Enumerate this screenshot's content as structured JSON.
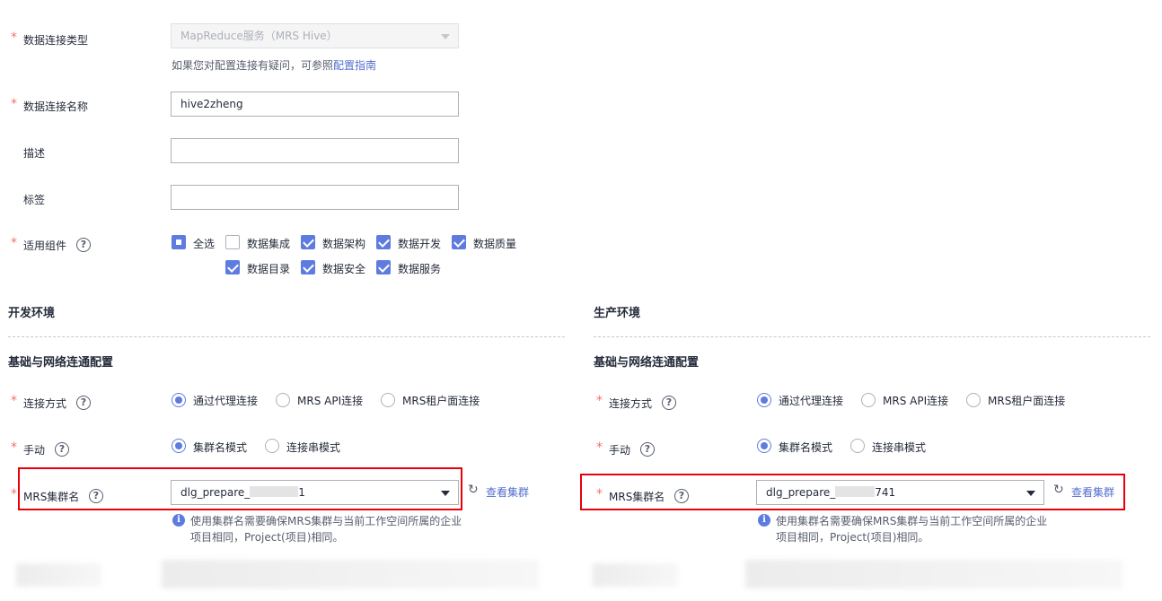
{
  "form": {
    "conn_type": {
      "label": "数据连接类型",
      "value": "MapReduce服务（MRS Hive）",
      "hint_prefix": "如果您对配置连接有疑问，可参照",
      "hint_link": "配置指南"
    },
    "conn_name": {
      "label": "数据连接名称",
      "value": "hive2zheng"
    },
    "desc": {
      "label": "描述",
      "value": ""
    },
    "tags": {
      "label": "标签",
      "value": ""
    },
    "components": {
      "label": "适用组件",
      "items": [
        {
          "label": "全选",
          "state": "partial"
        },
        {
          "label": "数据集成",
          "state": "unchecked"
        },
        {
          "label": "数据架构",
          "state": "checked"
        },
        {
          "label": "数据开发",
          "state": "checked"
        },
        {
          "label": "数据质量",
          "state": "checked"
        },
        {
          "label": "数据目录",
          "state": "checked"
        },
        {
          "label": "数据安全",
          "state": "checked"
        },
        {
          "label": "数据服务",
          "state": "checked"
        }
      ]
    }
  },
  "dev": {
    "title": "开发环境",
    "subtitle": "基础与网络连通配置",
    "conn_method": {
      "label": "连接方式",
      "options": [
        "通过代理连接",
        "MRS API连接",
        "MRS租户面连接"
      ],
      "selected": 0
    },
    "manual": {
      "label": "手动",
      "options": [
        "集群名模式",
        "连接串模式"
      ],
      "selected": 0
    },
    "cluster": {
      "label": "MRS集群名",
      "value_prefix": "dlg_prepare_",
      "value_suffix": "1",
      "view_link": "查看集群"
    },
    "hint_line1": "使用集群名需要确保MRS集群与当前工作空间所属的企业",
    "hint_line2": "项目相同，Project(项目)相同。"
  },
  "prod": {
    "title": "生产环境",
    "subtitle": "基础与网络连通配置",
    "conn_method": {
      "label": "连接方式",
      "options": [
        "通过代理连接",
        "MRS API连接",
        "MRS租户面连接"
      ],
      "selected": 0
    },
    "manual": {
      "label": "手动",
      "options": [
        "集群名模式",
        "连接串模式"
      ],
      "selected": 0
    },
    "cluster": {
      "label": "MRS集群名",
      "value_prefix": "dlg_prepare_",
      "value_suffix": "741",
      "view_link": "查看集群"
    },
    "hint_line1": "使用集群名需要确保MRS集群与当前工作空间所属的企业",
    "hint_line2": "项目相同，Project(项目)相同。"
  },
  "colors": {
    "accent": "#5e7ce0",
    "required": "#f66f6a",
    "highlight": "#e8000b",
    "link": "#526ecc"
  },
  "icons": {
    "help": "help-circle-icon",
    "info": "info-icon",
    "refresh": "refresh-icon",
    "dropdown": "caret-down-icon"
  },
  "glyphs": {
    "required": "*",
    "help": "?",
    "info": "i",
    "refresh": "↻"
  }
}
